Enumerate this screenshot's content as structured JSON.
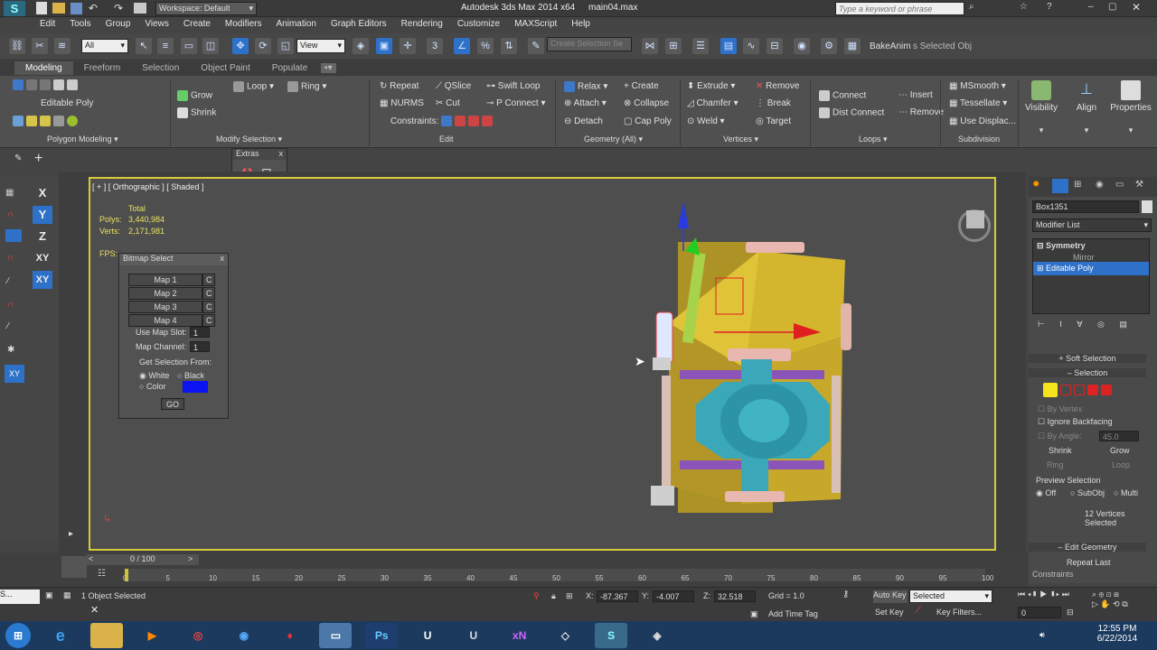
{
  "title_bar": {
    "workspace": "Workspace: Default",
    "app_title": "Autodesk 3ds Max 2014 x64",
    "file": "main04.max",
    "search_placeholder": "Type a keyword or phrase"
  },
  "menu": [
    "Edit",
    "Tools",
    "Group",
    "Views",
    "Create",
    "Modifiers",
    "Animation",
    "Graph Editors",
    "Rendering",
    "Customize",
    "MAXScript",
    "Help"
  ],
  "toolbar": {
    "filter": "All",
    "ref_coord": "View",
    "selection_set": "Create Selection Se",
    "bake": "BakeAnim",
    "selected_obj": "s Selected Obj"
  },
  "ribbon_tabs": [
    "Modeling",
    "Freeform",
    "Selection",
    "Object Paint",
    "Populate"
  ],
  "ribbon": {
    "editable_poly": "Editable Poly",
    "grow": "Grow",
    "shrink": "Shrink",
    "loop": "Loop",
    "ring": "Ring",
    "repeat": "Repeat",
    "qslice": "QSlice",
    "swift_loop": "Swift Loop",
    "nurms": "NURMS",
    "cut": "Cut",
    "p_connect": "P Connect",
    "constraints": "Constraints:",
    "relax": "Relax",
    "create": "Create",
    "attach": "Attach",
    "collapse": "Collapse",
    "detach": "Detach",
    "cap_poly": "Cap Poly",
    "extrude": "Extrude",
    "remove": "Remove",
    "chamfer": "Chamfer",
    "break": "Break",
    "weld": "Weld",
    "target": "Target",
    "connect": "Connect",
    "insert": "Insert",
    "dist_connect": "Dist Connect",
    "remove2": "Remove",
    "msmooth": "MSmooth",
    "tessellate": "Tessellate",
    "use_displac": "Use Displac...",
    "visibility": "Visibility",
    "align": "Align",
    "properties": "Properties",
    "groups": {
      "polygon_modeling": "Polygon Modeling",
      "modify_selection": "Modify Selection",
      "edit": "Edit",
      "geometry": "Geometry (All)",
      "vertices": "Vertices",
      "loops": "Loops",
      "subdivision": "Subdivision"
    }
  },
  "extras": {
    "title": "Extras",
    "close": "x"
  },
  "viewport": {
    "label": "[ + ] [ Orthographic ] [ Shaded ]",
    "stats_total": "Total",
    "polys_label": "Polys:",
    "polys_value": "3,440,984",
    "verts_label": "Verts:",
    "verts_value": "2,171,981",
    "fps_label": "FPS:"
  },
  "left_axes": [
    "X",
    "Y",
    "Z",
    "XY",
    "XY"
  ],
  "bitmap_select": {
    "title": "Bitmap Select",
    "close": "x",
    "maps": [
      "Map 1",
      "Map 2",
      "Map 3",
      "Map 4"
    ],
    "c": "C",
    "use_map_slot": "Use Map Slot:",
    "map_slot_value": "1",
    "map_channel": "Map Channel:",
    "map_channel_value": "1",
    "get_selection_from": "Get Selection From:",
    "white": "White",
    "black": "Black",
    "color": "Color",
    "color_hex": "#0a13f0",
    "go": "GO"
  },
  "command_panel": {
    "object_name": "Box1351",
    "modifier_list": "Modifier List",
    "stack": [
      "Symmetry",
      "Mirror",
      "Editable Poly"
    ],
    "soft_selection": "Soft Selection",
    "selection": "Selection",
    "by_vertex": "By Vertex",
    "ignore_backfacing": "Ignore Backfacing",
    "by_angle": "By Angle:",
    "angle_value": "45.0",
    "shrink": "Shrink",
    "grow": "Grow",
    "ring": "Ring",
    "loop": "Loop",
    "preview_selection": "Preview Selection",
    "off": "Off",
    "subobj": "SubObj",
    "multi": "Multi",
    "vertices_selected": "12 Vertices Selected",
    "edit_geometry": "Edit Geometry",
    "repeat_last": "Repeat Last",
    "constraints": "Constraints"
  },
  "timeline": {
    "frame": "0 / 100",
    "ticks": [
      "0",
      "5",
      "10",
      "15",
      "20",
      "25",
      "30",
      "35",
      "40",
      "45",
      "50",
      "55",
      "60",
      "65",
      "70",
      "75",
      "80",
      "85",
      "90",
      "95",
      "100"
    ]
  },
  "status": {
    "objects_selected": "1 Object Selected",
    "x_label": "X:",
    "x_value": "-87.367",
    "y_label": "Y:",
    "y_value": "-4.007",
    "z_label": "Z:",
    "z_value": "32.518",
    "grid": "Grid = 1.0",
    "add_time_tag": "Add Time Tag",
    "auto_key": "Auto Key",
    "set_key": "Set Key",
    "key_mode": "Selected",
    "key_filters": "Key Filters...",
    "frame_value": "0"
  },
  "taskbar": {
    "time": "12:55 PM",
    "date": "6/22/2014"
  }
}
